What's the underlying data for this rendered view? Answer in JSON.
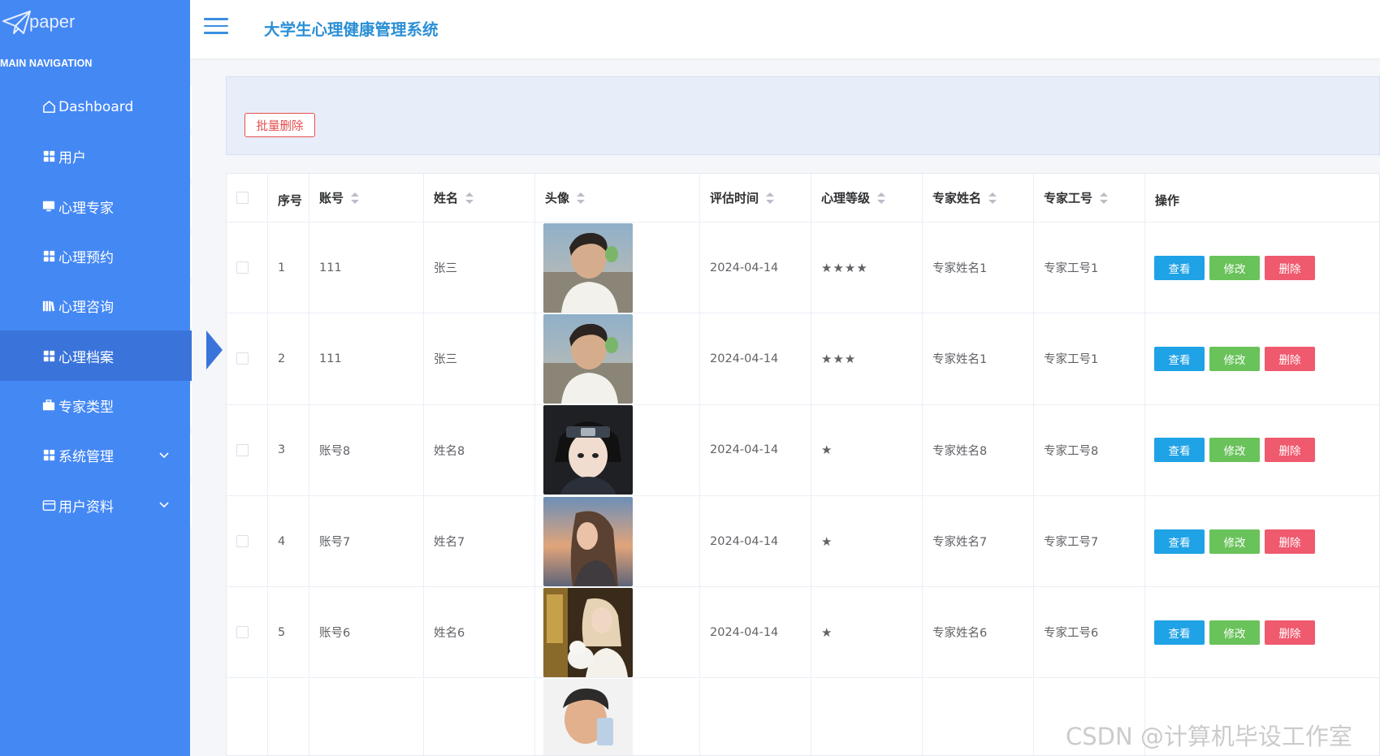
{
  "brand": {
    "logo_text": "paper"
  },
  "sidebar": {
    "caption": "MAIN NAVIGATION",
    "items": [
      {
        "label": "Dashboard",
        "icon": "home-icon"
      },
      {
        "label": "用户",
        "icon": "grid-icon"
      },
      {
        "label": "心理专家",
        "icon": "monitor-icon"
      },
      {
        "label": "心理预约",
        "icon": "grid-icon"
      },
      {
        "label": "心理咨询",
        "icon": "books-icon"
      },
      {
        "label": "心理档案",
        "icon": "grid-icon",
        "active": true
      },
      {
        "label": "专家类型",
        "icon": "briefcase-icon"
      },
      {
        "label": "系统管理",
        "icon": "grid-icon",
        "expandable": true
      },
      {
        "label": "用户资料",
        "icon": "card-icon",
        "expandable": true
      }
    ]
  },
  "header": {
    "title": "大学生心理健康管理系统"
  },
  "toolbar": {
    "batch_delete_label": "批量删除"
  },
  "table": {
    "columns": [
      "序号",
      "账号",
      "姓名",
      "头像",
      "评估时间",
      "心理等级",
      "专家姓名",
      "专家工号",
      "操作"
    ],
    "rows": [
      {
        "index": "1",
        "account": "111",
        "name": "张三",
        "avatar": "young-man-photo",
        "date": "2024-04-14",
        "level": "★★★★",
        "expert_name": "专家姓名1",
        "expert_id": "专家工号1"
      },
      {
        "index": "2",
        "account": "111",
        "name": "张三",
        "avatar": "young-man-photo",
        "date": "2024-04-14",
        "level": "★★★",
        "expert_name": "专家姓名1",
        "expert_id": "专家工号1"
      },
      {
        "index": "3",
        "account": "账号8",
        "name": "姓名8",
        "avatar": "anime-ninja-photo",
        "date": "2024-04-14",
        "level": "★",
        "expert_name": "专家姓名8",
        "expert_id": "专家工号8"
      },
      {
        "index": "4",
        "account": "账号7",
        "name": "姓名7",
        "avatar": "woman-sunset-photo",
        "date": "2024-04-14",
        "level": "★",
        "expert_name": "专家姓名7",
        "expert_id": "专家工号7"
      },
      {
        "index": "5",
        "account": "账号6",
        "name": "姓名6",
        "avatar": "woman-dog-photo",
        "date": "2024-04-14",
        "level": "★",
        "expert_name": "专家姓名6",
        "expert_id": "专家工号6"
      }
    ],
    "partial_row": {
      "avatar": "cartoon-man-photo"
    },
    "actions": {
      "view": "查看",
      "edit": "修改",
      "delete": "删除"
    }
  },
  "watermark": "CSDN @计算机毕设工作室",
  "colors": {
    "sidebar": "#4488f4",
    "active": "#3a74db",
    "title": "#2b8fd6",
    "view": "#1fa2e6",
    "edit": "#69c25a",
    "delete": "#ef5a6e"
  }
}
